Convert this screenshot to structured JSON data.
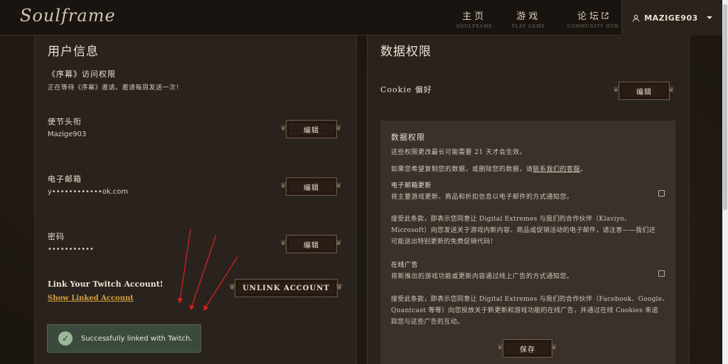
{
  "header": {
    "logo": "Soulframe",
    "nav": [
      {
        "label": "主页",
        "sub": "SOULFRAME"
      },
      {
        "label": "游戏",
        "sub": "PLAY GAME"
      },
      {
        "label": "论坛",
        "sub": "COMMUNITY HUB"
      }
    ],
    "username": "MAZIGE903"
  },
  "user_info": {
    "title": "用户信息",
    "prologue_title": "《序幕》访问权限",
    "prologue_text": "正在等待《序幕》邀请。邀请每周发送一次！",
    "envoy_label": "使节头衔",
    "envoy_value": "Mazige903",
    "email_label": "电子邮箱",
    "email_value": "y••••••••••••ok.com",
    "password_label": "密码",
    "password_value": "•••••••••••",
    "edit_label": "编辑",
    "twitch_title": "Link Your Twitch Account!",
    "twitch_link": "Show Linked Account",
    "unlink_label": "UNLINK ACCOUNT",
    "toast_text": "Successfully linked with Twitch."
  },
  "data_rights": {
    "title": "数据权限",
    "cookie_label": "Cookie 偏好",
    "edit_label": "编辑",
    "box_title": "数据权限",
    "box_note": "这些权限更改最长可能需要 21 天才会生效。",
    "copy_text": "如果您希望复制您的数据，或删除您的数据，请",
    "copy_link": "联系我们的客服",
    "copy_end": "。",
    "email_updates_title": "电子邮箱更新",
    "email_updates_desc": "将主要游戏更新、商品和折扣信息以电子邮件的方式通知您。",
    "email_consent_1": "接受此条款，即表示您同意让 Digital Extremes 与我们的合作伙伴（Klaviyo、",
    "email_consent_2": "Microsoft）向您发送关于游戏内新内容、商品或促销活动的电子邮件，请注意——我们还",
    "email_consent_3": "可能送出特别更新的免费促销代码！",
    "ads_title": "在线广告",
    "ads_desc": "将新推出的游戏功能或更新内容通过线上广告的方式通知您。",
    "ads_consent_1": "接受此条款，即表示您同意让 Digital Extremes 与我们的合作伙伴（Facebook、Google、",
    "ads_consent_2": "Quantcast 等等）向您投放关于新更新和游戏功能的在线广告，并通过在线 Cookies 来追",
    "ads_consent_3": "踪您与这些广告的互动。",
    "save_label": "保存"
  },
  "colors": {
    "accent_gold": "#d4a03c",
    "toast_green": "#3b4a3d",
    "arrow_red": "#e02020"
  }
}
